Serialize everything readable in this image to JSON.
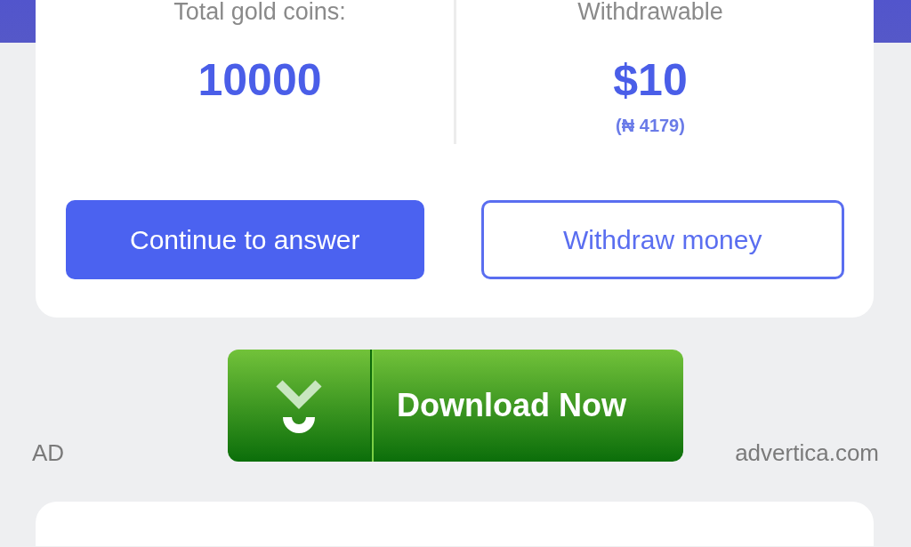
{
  "stats": [
    {
      "label": "Total gold coins:",
      "value": "10000"
    },
    {
      "label": "Withdrawable",
      "value": "$10",
      "note": "(₦ 4179)"
    }
  ],
  "buttons": [
    {
      "label": "Continue to answer",
      "kind": "primary"
    },
    {
      "label": "Withdraw money",
      "kind": "outline"
    }
  ],
  "ad": {
    "tag": "AD",
    "button": "Download Now",
    "domain": "advertica.com"
  }
}
